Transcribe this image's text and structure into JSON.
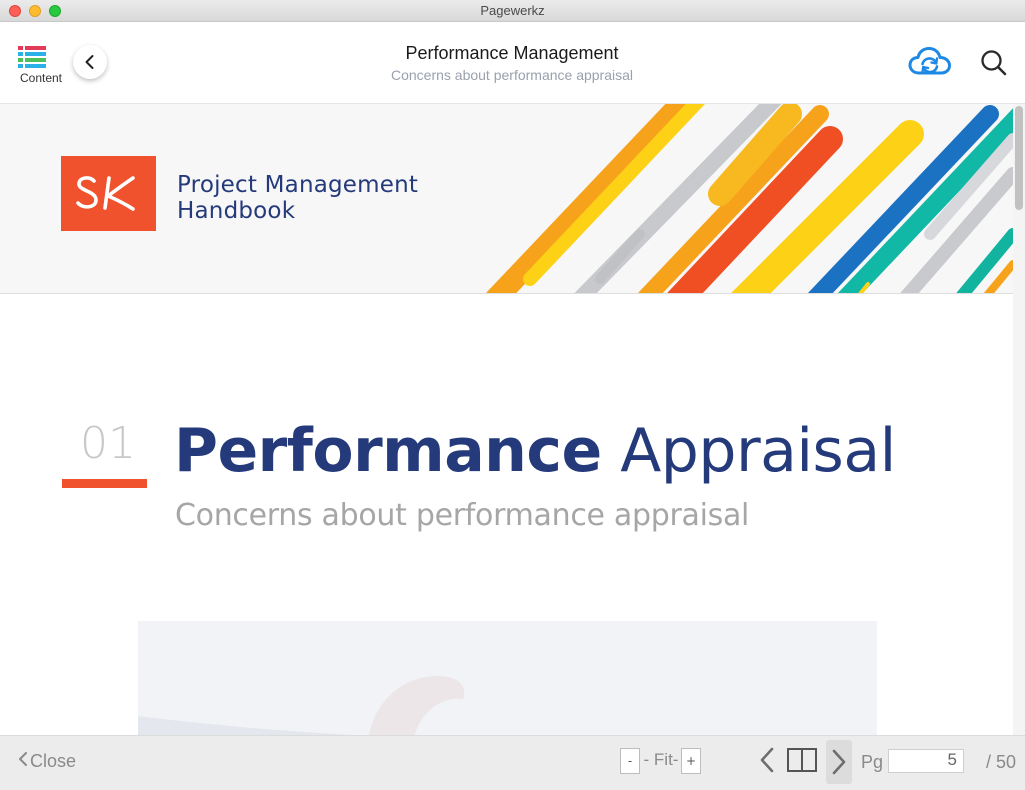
{
  "window": {
    "title": "Pagewerkz"
  },
  "header": {
    "content_label": "Content",
    "title": "Performance Management",
    "subtitle": "Concerns about performance appraisal"
  },
  "banner": {
    "logo_text": "SK",
    "title_line1": "Project Management",
    "title_line2": "Handbook"
  },
  "chapter": {
    "number": "01",
    "title_bold": "Performance",
    "title_light": "Appraisal",
    "subtitle": "Concerns about performance appraisal"
  },
  "footer": {
    "close_label": "Close",
    "zoom_minus": "-",
    "zoom_fit": "- Fit-",
    "zoom_plus": "+",
    "pg_label": "Pg",
    "page_value": "5",
    "page_total": "/ 50"
  },
  "colors": {
    "accent_orange": "#f0522e",
    "brand_navy": "#243a7a",
    "sync_blue": "#1e88e5"
  },
  "icons": {
    "content": "content-list-icon",
    "back": "chevron-left-icon",
    "sync": "cloud-sync-icon",
    "search": "search-icon",
    "prev": "chevron-left-icon",
    "book": "book-icon",
    "next": "chevron-right-icon"
  }
}
